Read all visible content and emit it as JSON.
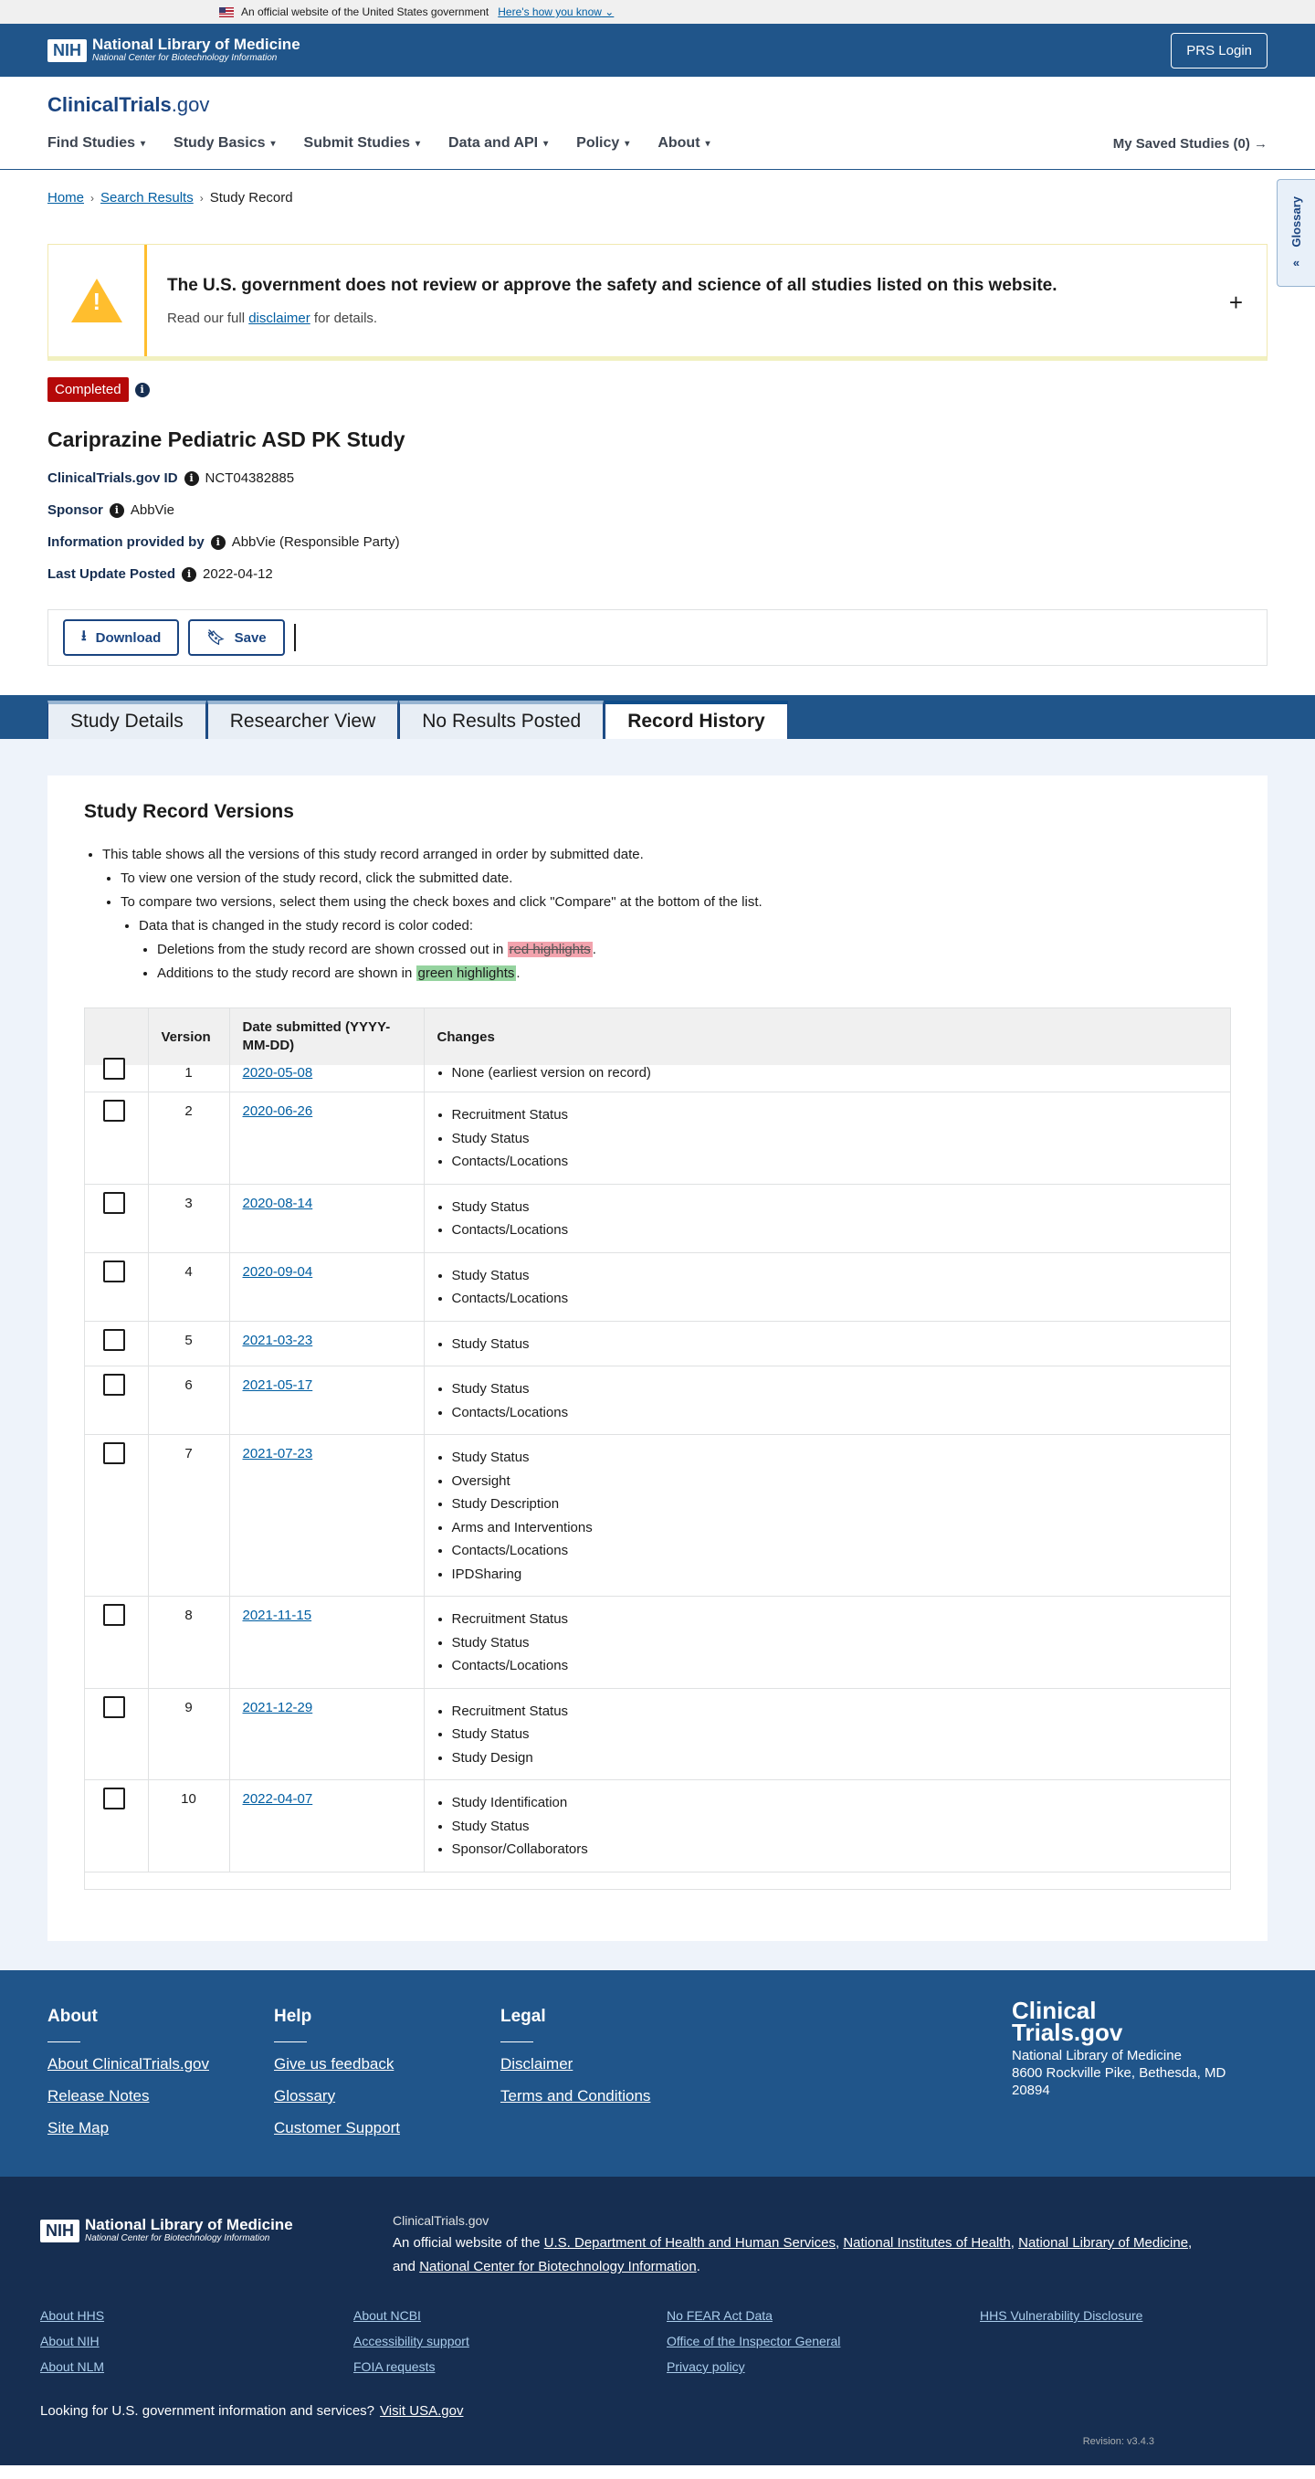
{
  "gov_banner": {
    "text": "An official website of the United States government",
    "how_link": "Here's how you know"
  },
  "nih_header": {
    "title": "National Library of Medicine",
    "subtitle": "National Center for Biotechnology Information",
    "box": "NIH",
    "prs_login": "PRS Login"
  },
  "site": {
    "brand_main": "ClinicalTrials",
    "brand_gov": ".gov"
  },
  "nav": {
    "items": [
      "Find Studies",
      "Study Basics",
      "Submit Studies",
      "Data and API",
      "Policy",
      "About"
    ],
    "saved": "My Saved Studies (0)"
  },
  "glossary_tab": "Glossary",
  "breadcrumb": {
    "home": "Home",
    "search": "Search Results",
    "current": "Study Record"
  },
  "alert": {
    "heading": "The U.S. government does not review or approve the safety and science of all studies listed on this website.",
    "sub_before": "Read our full ",
    "sub_link": "disclaimer",
    "sub_after": " for details."
  },
  "study": {
    "status": "Completed",
    "title": "Cariprazine Pediatric ASD PK Study",
    "meta": [
      {
        "key": "ClinicalTrials.gov ID",
        "value": "NCT04382885"
      },
      {
        "key": "Sponsor",
        "value": "AbbVie"
      },
      {
        "key": "Information provided by",
        "value": "AbbVie (Responsible Party)"
      },
      {
        "key": "Last Update Posted",
        "value": "2022-04-12"
      }
    ],
    "download": "Download",
    "save": "Save"
  },
  "tabs": [
    "Study Details",
    "Researcher View",
    "No Results Posted",
    "Record History"
  ],
  "history": {
    "title": "Study Record Versions",
    "note1": "This table shows all the versions of this study record arranged in order by submitted date.",
    "note2": "To view one version of the study record, click the submitted date.",
    "note3": "To compare two versions, select them using the check boxes and click \"Compare\" at the bottom of the list.",
    "note4": "Data that is changed in the study record is color coded:",
    "del_before": "Deletions from the study record are shown crossed out in ",
    "del_mark": "red highlights",
    "add_before": "Additions to the study record are shown in ",
    "add_mark": "green highlights",
    "period": ".",
    "columns": [
      "Version",
      "Date submitted (YYYY-MM-DD)",
      "Changes"
    ],
    "rows": [
      {
        "version": "1",
        "date": "2020-05-08",
        "changes": [
          "None (earliest version on record)"
        ]
      },
      {
        "version": "2",
        "date": "2020-06-26",
        "changes": [
          "Recruitment Status",
          "Study Status",
          "Contacts/Locations"
        ]
      },
      {
        "version": "3",
        "date": "2020-08-14",
        "changes": [
          "Study Status",
          "Contacts/Locations"
        ]
      },
      {
        "version": "4",
        "date": "2020-09-04",
        "changes": [
          "Study Status",
          "Contacts/Locations"
        ]
      },
      {
        "version": "5",
        "date": "2021-03-23",
        "changes": [
          "Study Status"
        ]
      },
      {
        "version": "6",
        "date": "2021-05-17",
        "changes": [
          "Study Status",
          "Contacts/Locations"
        ]
      },
      {
        "version": "7",
        "date": "2021-07-23",
        "changes": [
          "Study Status",
          "Oversight",
          "Study Description",
          "Arms and Interventions",
          "Contacts/Locations",
          "IPDSharing"
        ]
      },
      {
        "version": "8",
        "date": "2021-11-15",
        "changes": [
          "Recruitment Status",
          "Study Status",
          "Contacts/Locations"
        ]
      },
      {
        "version": "9",
        "date": "2021-12-29",
        "changes": [
          "Recruitment Status",
          "Study Status",
          "Study Design"
        ]
      },
      {
        "version": "10",
        "date": "2022-04-07",
        "changes": [
          "Study Identification",
          "Study Status",
          "Sponsor/Collaborators"
        ]
      }
    ]
  },
  "footer": {
    "columns": [
      {
        "title": "About",
        "links": [
          "About ClinicalTrials.gov",
          "Release Notes",
          "Site Map"
        ]
      },
      {
        "title": "Help",
        "links": [
          "Give us feedback",
          "Glossary",
          "Customer Support"
        ]
      },
      {
        "title": "Legal",
        "links": [
          "Disclaimer",
          "Terms and Conditions"
        ]
      }
    ],
    "logo_line1": "Clinical",
    "logo_line2": "Trials.gov",
    "address1": "National Library of Medicine",
    "address2": "8600 Rockville Pike, Bethesda, MD",
    "address3": "20894"
  },
  "footer_bottom": {
    "site": "ClinicalTrials.gov",
    "official_prefix": "An official website of the ",
    "hhs": "U.S. Department of Health and Human Services",
    "nih": "National Institutes of Health",
    "nlm": "National Library of Medicine",
    "and": "and ",
    "ncbi": "National Center for Biotechnology Information",
    "links": [
      "About HHS",
      "About NCBI",
      "No FEAR Act Data",
      "HHS Vulnerability Disclosure",
      "About NIH",
      "Accessibility support",
      "Office of the Inspector General",
      "About NLM",
      "FOIA requests",
      "Privacy policy"
    ],
    "usa_text": "Looking for U.S. government information and services?",
    "usa_link": "Visit USA.gov",
    "revision": "Revision: v3.4.3"
  },
  "colors": {
    "primary": "#20558a",
    "dark": "#162e51",
    "status_red": "#b50909",
    "warning": "#ffbe2e"
  }
}
